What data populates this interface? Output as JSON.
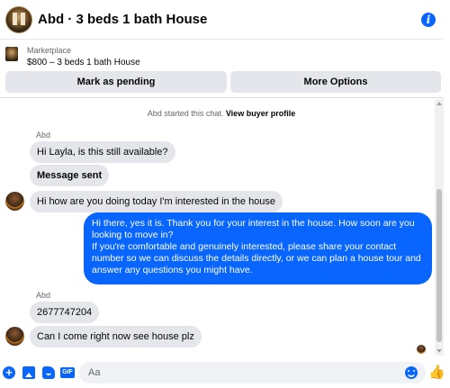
{
  "header": {
    "title": "Abd · 3 beds 1 bath House",
    "info_icon": "info-icon"
  },
  "listing": {
    "label": "Marketplace",
    "price_title": "$800 – 3 beds 1 bath House"
  },
  "actions": {
    "pending_label": "Mark as pending",
    "more_label": "More Options"
  },
  "chat": {
    "started_text": "Abd started this chat.",
    "view_profile_link": "View buyer profile",
    "sender_name_1": "Abd",
    "msg_1": "Hi Layla, is this still available?",
    "msg_2": "Message sent",
    "msg_3": "Hi how are you doing today I'm interested in the house",
    "reply_line_1": "Hi there, yes it is. Thank you for your interest in the house. How soon are you looking to move in?",
    "reply_line_2": "If you're comfortable and genuinely interested, please share your contact number so we can discuss the details directly, or we can plan a house tour and answer any questions you might have.",
    "sender_name_2": "Abd",
    "msg_4": "2677747204",
    "msg_5": "Can I come right now see house plz"
  },
  "composer": {
    "placeholder": "Aa",
    "gif_label": "GIF",
    "plus_label": "+"
  },
  "colors": {
    "accent": "#0866ff",
    "bubble_in": "#e4e6eb",
    "muted_text": "#65676b"
  }
}
